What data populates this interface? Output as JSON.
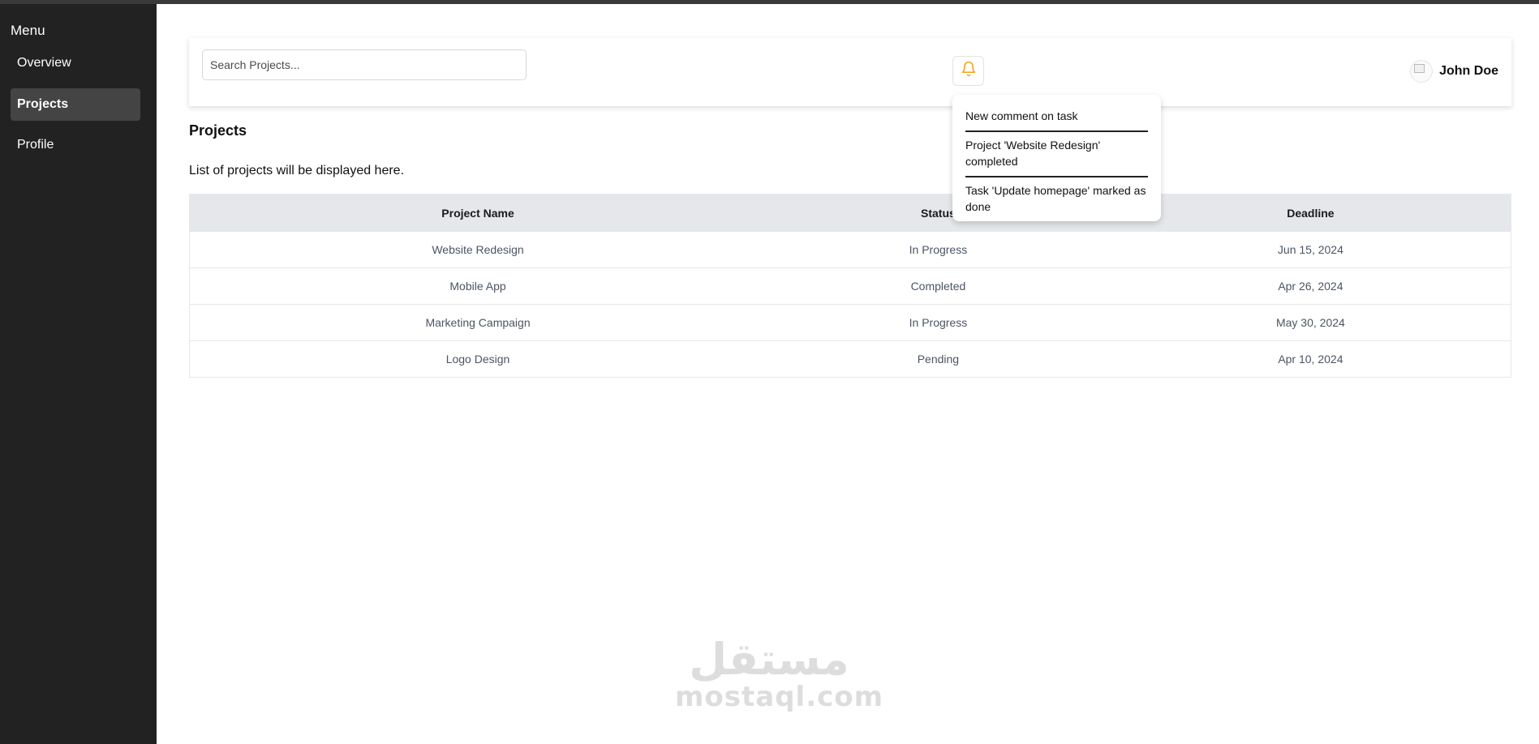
{
  "sidebar": {
    "title": "Menu",
    "items": [
      {
        "label": "Overview"
      },
      {
        "label": "Projects"
      },
      {
        "label": "Profile"
      }
    ]
  },
  "header": {
    "search_placeholder": "Search Projects...",
    "search_value": "",
    "bell_icon": "bell-icon",
    "user_name": "John Doe"
  },
  "notifications": [
    {
      "text": "New comment on task"
    },
    {
      "text": "Project 'Website Redesign' completed"
    },
    {
      "text": "Task 'Update homepage' marked as done"
    }
  ],
  "main": {
    "title": "Projects",
    "description": "List of projects will be displayed here.",
    "table": {
      "headers": [
        "Project Name",
        "Status",
        "Deadline"
      ],
      "rows": [
        {
          "name": "Website Redesign",
          "status": "In Progress",
          "deadline": "Jun 15, 2024"
        },
        {
          "name": "Mobile App",
          "status": "Completed",
          "deadline": "Apr 26, 2024"
        },
        {
          "name": "Marketing Campaign",
          "status": "In Progress",
          "deadline": "May 30, 2024"
        },
        {
          "name": "Logo Design",
          "status": "Pending",
          "deadline": "Apr 10, 2024"
        }
      ]
    }
  },
  "watermark": {
    "arabic": "مستقل",
    "latin": "mostaql.com"
  },
  "colors": {
    "sidebar_bg": "#222222",
    "active_item_bg": "#444444",
    "bell_color": "#f5a623",
    "table_header_bg": "#e5e7eb"
  }
}
